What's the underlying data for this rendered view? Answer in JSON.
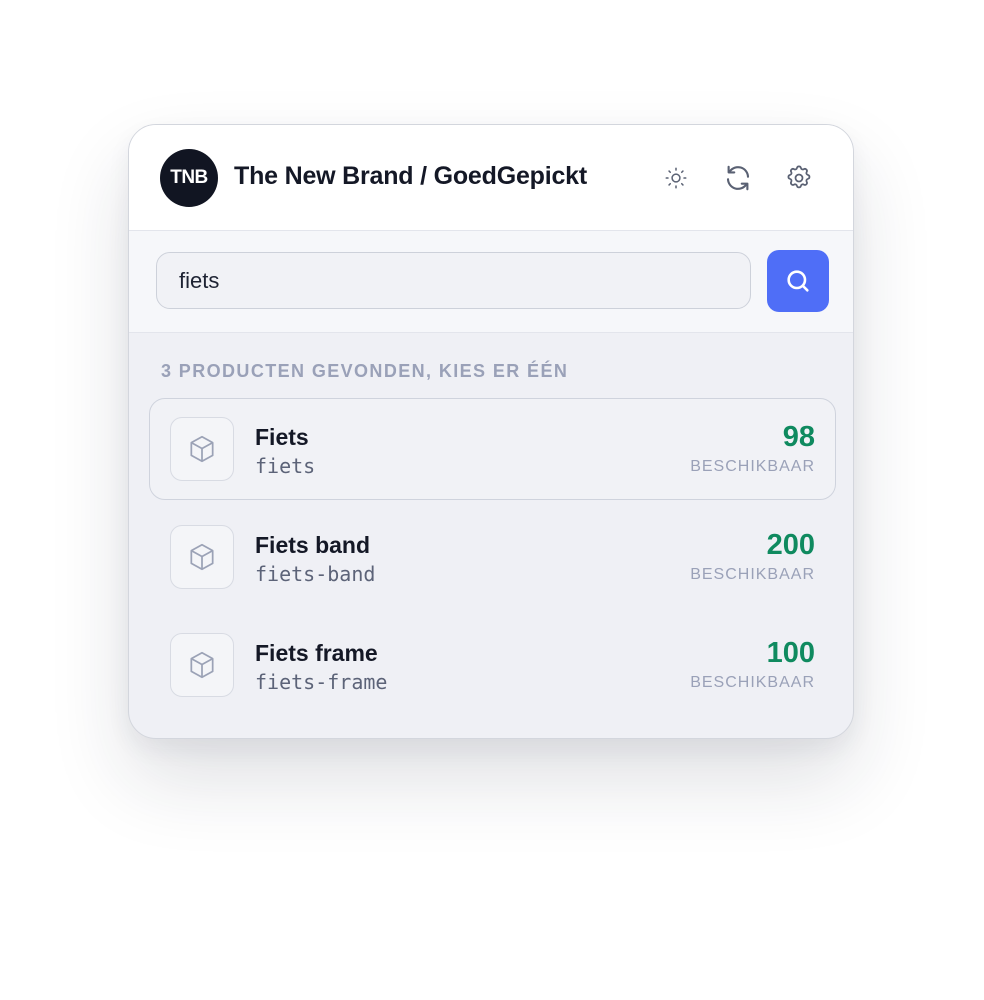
{
  "header": {
    "logo_text": "TNB",
    "title": "The New Brand / GoedGepickt",
    "icons": [
      "sun-icon",
      "refresh-icon",
      "gear-icon"
    ]
  },
  "search": {
    "value": "fiets",
    "button_icon": "search-icon"
  },
  "results": {
    "label": "3 PRODUCTEN GEVONDEN, KIES ER ÉÉN",
    "items": [
      {
        "name": "Fiets",
        "slug": "fiets",
        "quantity": "98",
        "availability_label": "BESCHIKBAAR",
        "icon": "box-icon",
        "selected": true
      },
      {
        "name": "Fiets band",
        "slug": "fiets-band",
        "quantity": "200",
        "availability_label": "BESCHIKBAAR",
        "icon": "box-icon",
        "selected": false
      },
      {
        "name": "Fiets frame",
        "slug": "fiets-frame",
        "quantity": "100",
        "availability_label": "BESCHIKBAAR",
        "icon": "box-icon",
        "selected": false
      }
    ]
  },
  "colors": {
    "accent": "#4f6ef7",
    "quantity": "#0f8a5f",
    "logo_bg": "#111522",
    "muted": "#9aa1b8"
  }
}
